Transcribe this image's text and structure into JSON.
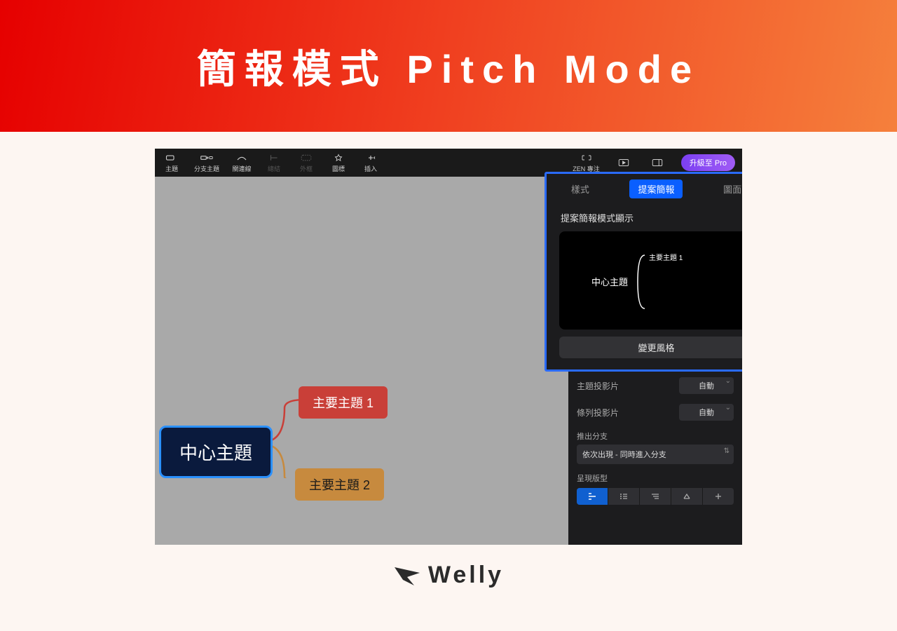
{
  "banner": {
    "title": "簡報模式 Pitch Mode"
  },
  "toolbar": {
    "items": [
      {
        "label": "主題"
      },
      {
        "label": "分支主題"
      },
      {
        "label": "關連線"
      },
      {
        "label": "總結"
      },
      {
        "label": "外框"
      },
      {
        "label": "圖標"
      },
      {
        "label": "插入"
      }
    ],
    "zen_label": "ZEN 專注",
    "upgrade_label": "升級至 Pro"
  },
  "mindmap": {
    "center": "中心主題",
    "topic1": "主要主題 1",
    "topic2": "主要主題 2"
  },
  "callout": {
    "tabs": {
      "style": "樣式",
      "pitch": "提案簡報",
      "image": "圖面"
    },
    "section_title": "提案簡報模式顯示",
    "preview_center": "中心主題",
    "preview_branch": "主要主題 1",
    "change_style": "變更風格"
  },
  "panel": {
    "topic_slides_label": "主題投影片",
    "topic_slides_value": "自動",
    "list_slides_label": "條列投影片",
    "list_slides_value": "自動",
    "branch_label": "推出分支",
    "branch_value": "依次出現 - 同時進入分支",
    "layout_label": "呈現版型"
  },
  "footer": {
    "brand": "Welly"
  }
}
